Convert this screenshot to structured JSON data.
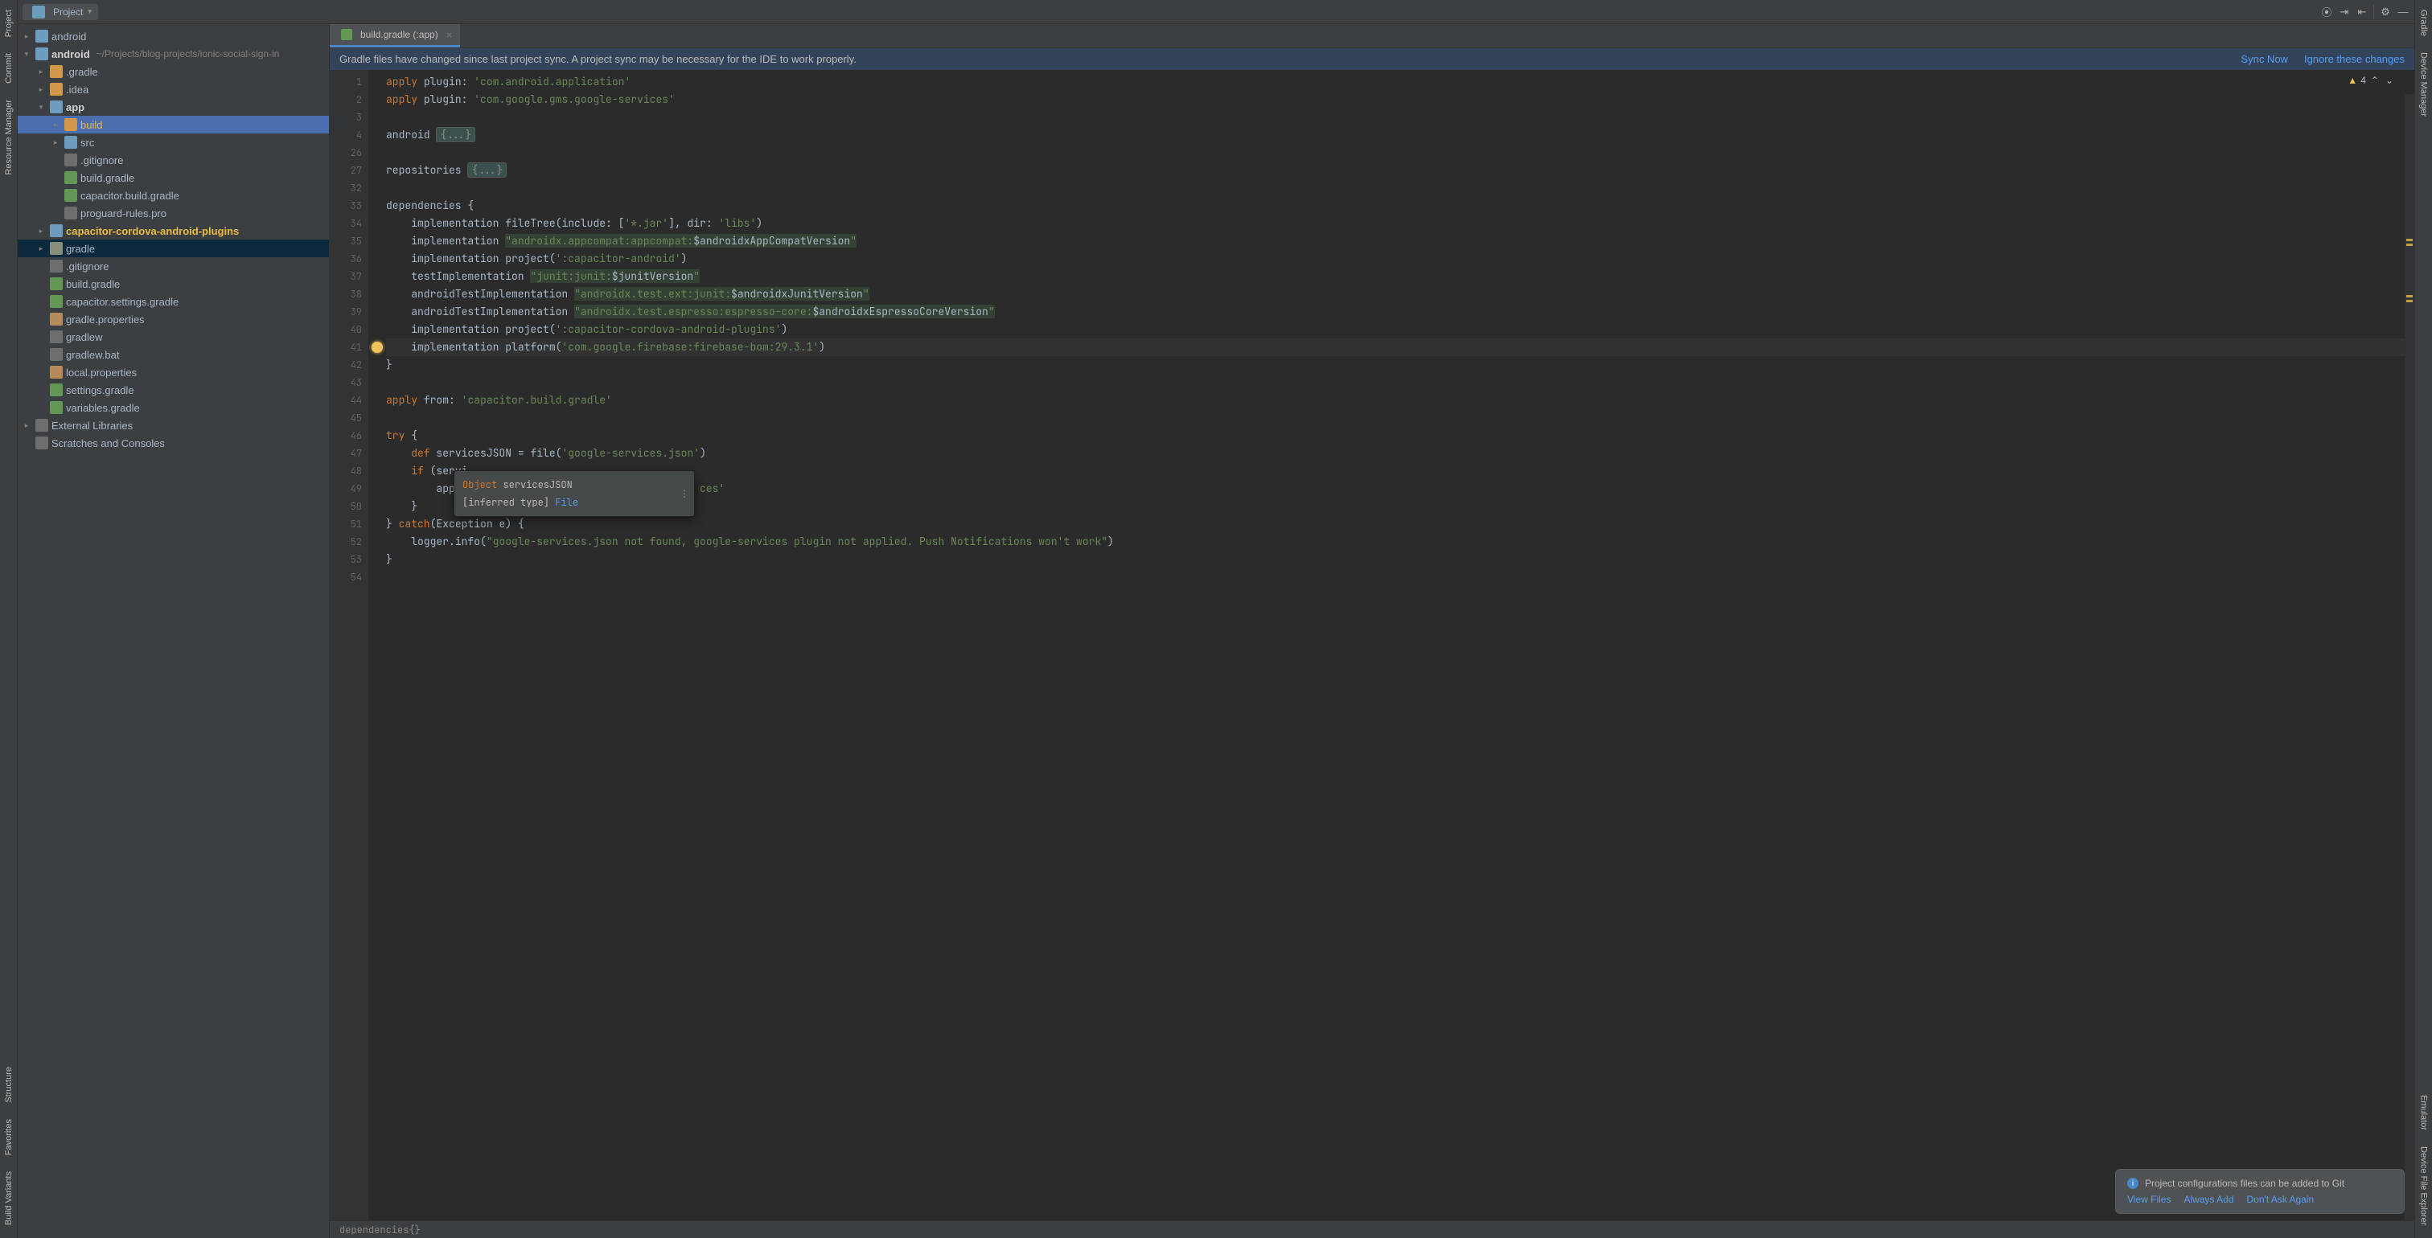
{
  "toolbar": {
    "project_label": "Project"
  },
  "left_tabs": [
    "Project",
    "Commit",
    "Resource Manager",
    "Structure",
    "Favorites",
    "Build Variants"
  ],
  "right_tabs": [
    "Gradle",
    "Device Manager",
    "Emulator",
    "Device File Explorer"
  ],
  "tree": [
    {
      "d": 0,
      "t": "closed",
      "ic": "ic-folder-mod",
      "label": "android"
    },
    {
      "d": 0,
      "t": "open",
      "ic": "ic-folder-mod",
      "label": "android",
      "bold": true,
      "path": "~/Projects/blog-projects/ionic-social-sign-in"
    },
    {
      "d": 1,
      "t": "closed",
      "ic": "ic-folder-o",
      "label": ".gradle"
    },
    {
      "d": 1,
      "t": "closed",
      "ic": "ic-folder-o",
      "label": ".idea"
    },
    {
      "d": 1,
      "t": "open",
      "ic": "ic-folder-mod",
      "label": "app",
      "bold": true
    },
    {
      "d": 2,
      "t": "closed",
      "ic": "ic-folder-o",
      "label": "build",
      "sel": true,
      "yellow": true
    },
    {
      "d": 2,
      "t": "closed",
      "ic": "ic-folder-mod",
      "label": "src"
    },
    {
      "d": 2,
      "t": "",
      "ic": "ic-file",
      "label": ".gitignore"
    },
    {
      "d": 2,
      "t": "",
      "ic": "ic-gradle",
      "label": "build.gradle"
    },
    {
      "d": 2,
      "t": "",
      "ic": "ic-gradle",
      "label": "capacitor.build.gradle"
    },
    {
      "d": 2,
      "t": "",
      "ic": "ic-file",
      "label": "proguard-rules.pro"
    },
    {
      "d": 1,
      "t": "closed",
      "ic": "ic-folder-mod",
      "label": "capacitor-cordova-android-plugins",
      "bold": true,
      "yellow": true
    },
    {
      "d": 1,
      "t": "closed",
      "ic": "ic-folder",
      "label": "gradle",
      "hl": true
    },
    {
      "d": 1,
      "t": "",
      "ic": "ic-file",
      "label": ".gitignore"
    },
    {
      "d": 1,
      "t": "",
      "ic": "ic-gradle",
      "label": "build.gradle"
    },
    {
      "d": 1,
      "t": "",
      "ic": "ic-gradle",
      "label": "capacitor.settings.gradle"
    },
    {
      "d": 1,
      "t": "",
      "ic": "ic-prop",
      "label": "gradle.properties"
    },
    {
      "d": 1,
      "t": "",
      "ic": "ic-file",
      "label": "gradlew"
    },
    {
      "d": 1,
      "t": "",
      "ic": "ic-file",
      "label": "gradlew.bat"
    },
    {
      "d": 1,
      "t": "",
      "ic": "ic-prop",
      "label": "local.properties"
    },
    {
      "d": 1,
      "t": "",
      "ic": "ic-gradle",
      "label": "settings.gradle"
    },
    {
      "d": 1,
      "t": "",
      "ic": "ic-gradle",
      "label": "variables.gradle"
    },
    {
      "d": 0,
      "t": "closed",
      "ic": "ic-file",
      "label": "External Libraries"
    },
    {
      "d": 0,
      "t": "",
      "ic": "ic-file",
      "label": "Scratches and Consoles"
    }
  ],
  "tab": {
    "label": "build.gradle (:app)"
  },
  "syncbar": {
    "msg": "Gradle files have changed since last project sync. A project sync may be necessary for the IDE to work properly.",
    "sync": "Sync Now",
    "ignore": "Ignore these changes"
  },
  "inspection": {
    "warn_count": "4"
  },
  "code_lines": [
    {
      "n": 1,
      "html": "<span class='kw'>apply</span> <span class='ident'>plugin</span>: <span class='str'>'com.android.application'</span>"
    },
    {
      "n": 2,
      "html": "<span class='kw'>apply</span> <span class='ident'>plugin</span>: <span class='str'>'com.google.gms.google-services'</span>"
    },
    {
      "n": 3,
      "html": ""
    },
    {
      "n": 4,
      "html": "<span class='ident'>android </span><span class='fold-box'>{...}</span>"
    },
    {
      "n": 26,
      "html": ""
    },
    {
      "n": 27,
      "html": "<span class='ident'>repositories </span><span class='fold-box'>{...}</span>"
    },
    {
      "n": 32,
      "html": ""
    },
    {
      "n": 33,
      "html": "<span class='ident'>dependencies</span> {"
    },
    {
      "n": 34,
      "html": "    <span class='ident'>implementation</span> <span class='ident'>fileTree</span>(<span class='ident'>include</span>: [<span class='str'>'*.jar'</span>], <span class='ident'>dir</span>: <span class='str'>'libs'</span>)"
    },
    {
      "n": 35,
      "html": "    <span class='ident'>implementation</span> <span class='gvar'>\"androidx.appcompat:appcompat:</span><span class='gvr2'>$androidxAppCompatVersion</span><span class='gvar'>\"</span>"
    },
    {
      "n": 36,
      "html": "    <span class='ident'>implementation</span> <span class='ident'>project</span>(<span class='str'>':capacitor-android'</span>)"
    },
    {
      "n": 37,
      "html": "    <span class='ident'>testImplementation</span> <span class='gvar'>\"junit:junit:</span><span class='gvr2'>$junitVersion</span><span class='gvar'>\"</span>"
    },
    {
      "n": 38,
      "html": "    <span class='ident'>androidTestImplementation</span> <span class='gvar'>\"androidx.test.ext:junit:</span><span class='gvr2'>$androidxJunitVersion</span><span class='gvar'>\"</span>"
    },
    {
      "n": 39,
      "html": "    <span class='ident'>androidTestImplementation</span> <span class='gvar'>\"androidx.test.espresso:espresso-core:</span><span class='gvr2'>$androidxEspressoCoreVersion</span><span class='gvar'>\"</span>"
    },
    {
      "n": 40,
      "html": "    <span class='ident'>implementation</span> <span class='ident'>project</span>(<span class='str'>':capacitor-cordova-android-plugins'</span>)"
    },
    {
      "n": 41,
      "html": "    <span class='ident'>implementation</span> <span class='ident'>platform</span>(<span class='str'>'com.google.firebase:firebase-bom:29.3.1'</span>)",
      "cursor": true,
      "bulb": true
    },
    {
      "n": 42,
      "html": "}"
    },
    {
      "n": 43,
      "html": ""
    },
    {
      "n": 44,
      "html": "<span class='kw'>apply</span> <span class='ident'>from</span>: <span class='str'>'capacitor.build.gradle'</span>"
    },
    {
      "n": 45,
      "html": ""
    },
    {
      "n": 46,
      "html": "<span class='kw'>try</span> {"
    },
    {
      "n": 47,
      "html": "    <span class='kw'>def</span> <span class='ident'>servicesJSON</span> = <span class='ident'>file</span>(<span class='str'>'google-services.json'</span>)"
    },
    {
      "n": 48,
      "html": "    <span class='kw'>if</span> (servi"
    },
    {
      "n": 49,
      "html": "        apply                                     <span class='str'>ces'</span>"
    },
    {
      "n": 50,
      "html": "    }"
    },
    {
      "n": 51,
      "html": "} <span class='kw'>catch</span>(Exception <span class='ident'>e</span>) {"
    },
    {
      "n": 52,
      "html": "    <span class='ident'>logger</span>.<span class='ident'>info</span>(<span class='str'>\"google-services.json not found, google-services plugin not applied. Push Notifications won't work\"</span>)"
    },
    {
      "n": 53,
      "html": "}"
    },
    {
      "n": 54,
      "html": ""
    }
  ],
  "hint": {
    "l1_kw": "Object",
    "l1_name": "servicesJSON",
    "l2_inf": "[inferred type]",
    "l2_type": "File"
  },
  "notif": {
    "title": "Project configurations files can be added to Git",
    "view": "View Files",
    "always": "Always Add",
    "dont": "Don't Ask Again"
  },
  "breadcrumb": "dependencies{}"
}
